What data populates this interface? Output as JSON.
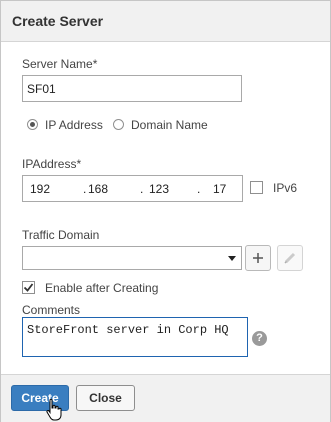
{
  "dialog": {
    "title": "Create Server"
  },
  "server_name": {
    "label": "Server Name*",
    "value": "SF01"
  },
  "address_type": {
    "options": [
      {
        "label": "IP Address",
        "selected": true
      },
      {
        "label": "Domain Name",
        "selected": false
      }
    ]
  },
  "ip": {
    "label": "IPAddress*",
    "octets": [
      "192",
      "168",
      "123",
      "17"
    ],
    "ipv6_label": "IPv6",
    "ipv6_checked": false
  },
  "traffic_domain": {
    "label": "Traffic Domain",
    "value": "",
    "add_icon": "plus-icon",
    "edit_icon": "pencil-icon"
  },
  "enable_after_creating": {
    "label": "Enable after Creating",
    "checked": true
  },
  "comments": {
    "label": "Comments",
    "value": "StoreFront server in Corp HQ",
    "help_icon": "?"
  },
  "footer": {
    "create_label": "Create",
    "close_label": "Close"
  }
}
